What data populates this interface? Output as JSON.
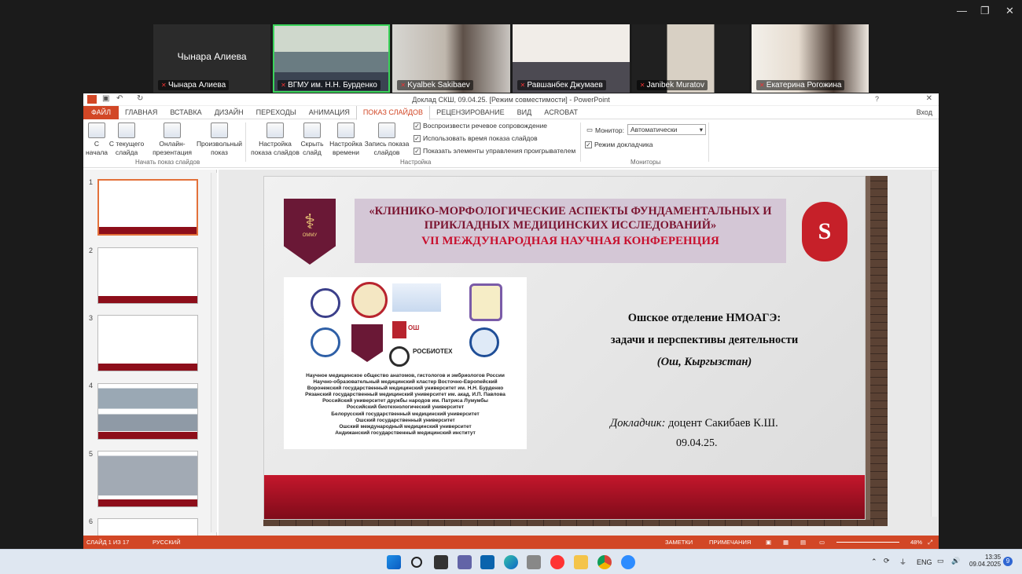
{
  "window_controls": {
    "minimize": "—",
    "restore": "❐",
    "close": "✕"
  },
  "participants": [
    {
      "name": "Чынара Алиева",
      "display": "Чынара Алиева",
      "muted": true,
      "video": false
    },
    {
      "name": "ВГМУ им. Н.Н. Бурденко",
      "muted": true,
      "video": true,
      "active": true
    },
    {
      "name": "Kyalbek Sakibaev",
      "muted": true,
      "video": true
    },
    {
      "name": "Равшанбек Джумаев",
      "muted": true,
      "video": true
    },
    {
      "name": "Janibek Muratov",
      "muted": true,
      "video": true
    },
    {
      "name": "Екатерина Рогожина",
      "muted": true,
      "video": true
    }
  ],
  "ppt": {
    "title": "Доклад СКШ, 09.04.25. [Режим совместимости] - PowerPoint",
    "signin": "Вход",
    "tabs": [
      "ФАЙЛ",
      "ГЛАВНАЯ",
      "ВСТАВКА",
      "ДИЗАЙН",
      "ПЕРЕХОДЫ",
      "АНИМАЦИЯ",
      "ПОКАЗ СЛАЙДОВ",
      "РЕЦЕНЗИРОВАНИЕ",
      "ВИД",
      "ACROBAT"
    ],
    "active_tab": "ПОКАЗ СЛАЙДОВ",
    "ribbon": {
      "btn_from_start": "С начала",
      "btn_from_current": "С текущего слайда",
      "btn_online": "Онлайн-презентация",
      "btn_custom": "Произвольный показ",
      "group_start": "Начать показ слайдов",
      "btn_setup": "Настройка показа слайдов",
      "btn_hide": "Скрыть слайд",
      "btn_timing": "Настройка времени",
      "btn_record": "Запись показа слайдов",
      "chk_narration": "Воспроизвести речевое сопровождение",
      "chk_timings": "Использовать время показа слайдов",
      "chk_controls": "Показать элементы управления проигрывателем",
      "group_setup": "Настройка",
      "monitor_label": "Монитор:",
      "monitor_value": "Автоматически",
      "presenter_view": "Режим докладчика",
      "group_monitors": "Мониторы"
    },
    "thumbs": [
      "1",
      "2",
      "3",
      "4",
      "5",
      "6"
    ],
    "slide": {
      "title1": "«КЛИНИКО-МОРФОЛОГИЧЕСКИЕ АСПЕКТЫ ФУНДАМЕНТАЛЬНЫХ И",
      "title2": "ПРИКЛАДНЫХ МЕДИЦИНСКИХ ИССЛЕДОВАНИЙ»",
      "title3": "VII МЕЖДУНАРОДНАЯ НАУЧНАЯ КОНФЕРЕНЦИЯ",
      "logo_left": "ОММУ",
      "logo_right": "S",
      "orgs": [
        "Научное медицинское общество анатомов, гистологов и эмбриологов России",
        "Научно-образовательный медицинский кластер Восточно-Европейский",
        "Воронежский государственный медицинский университет им. Н.Н. Бурденко",
        "Рязанский государственный медицинский университет им. акад. И.П. Павлова",
        "Российский университет дружбы народов им. Патриса Лумумбы",
        "Российский биотехнологический университет",
        "Белорусский государственный медицинский университет",
        "Ошский государственный университет",
        "Ошский международный медицинский университет",
        "Андижанский государственный медицинский институт"
      ],
      "logo_biotech": "РОСБИОТЕХ",
      "logo_osh": "ОШ",
      "talk1": "Ошское отделение НМОАГЭ:",
      "talk2": "задачи и перспективы деятельности",
      "talk3": "(Ош, Кыргызстан)",
      "reporter_label": "Докладчик:",
      "reporter": "доцент Сакибаев К.Ш.",
      "date": "09.04.25."
    },
    "status": {
      "slide": "СЛАЙД 1 ИЗ 17",
      "lang": "РУССКИЙ",
      "notes": "ЗАМЕТКИ",
      "comments": "ПРИМЕЧАНИЯ",
      "zoom": "48%"
    }
  },
  "taskbar": {
    "lang": "ENG",
    "time": "13:35",
    "date": "09.04.2025",
    "badge": "9"
  },
  "colors": {
    "accent": "#d24726",
    "maroon": "#8d0e1a",
    "title_purple": "#7b1430",
    "title_red": "#c8102e"
  }
}
